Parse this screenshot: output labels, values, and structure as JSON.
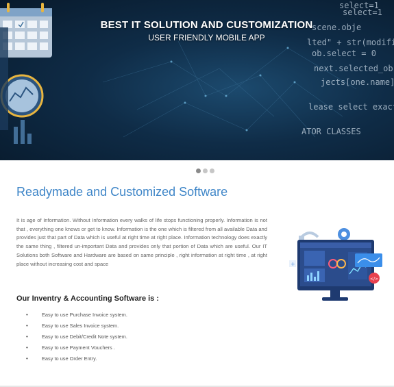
{
  "hero": {
    "title": "BEST IT SOLUTION AND CUSTOMIZATION",
    "subtitle": "USER FRIENDLY MOBILE APP",
    "code_lines": [
      "select=1",
      "select=1",
      "scene.obje",
      "lted\" + str(modifie",
      "ob.select = 0",
      "next.selected_ob",
      "jects[one.name].se",
      "lease select exactly",
      "ATOR CLASSES"
    ]
  },
  "slider": {
    "slide_count": 3,
    "active_index": 0
  },
  "section": {
    "title": "Readymade and Customized Software",
    "intro": "It is age of Information. Without Information every walks of life stops functioning properly. Information is not that , everything one knows or get to know. Information is the one which is filtered from all available Data and provides just that part of Data which is useful at right time at right place. Information technology does exactly the same thing , filtered un-important Data and provides only that portion of Data which are useful. Our IT Solutions both Software and Hardware are based on same principle , right information at right time , at right place without increasing cost and space"
  },
  "software": {
    "heading": "Our Inventry & Accounting Software is :",
    "bullet": "•",
    "features": [
      "Easy to use Purchase Invoice system.",
      "Easy to use Sales Invoice system.",
      "Easy to use Debit/Credit Note system.",
      "Easy to use Payment Vouchers .",
      "Easy to use Order Entry."
    ]
  },
  "illustration": {
    "icon": "computer-dashboard-icon",
    "code_badge": "</>"
  },
  "colors": {
    "accent": "#3f86c8",
    "hero_bg": "#0f2c47",
    "text": "#666666"
  }
}
